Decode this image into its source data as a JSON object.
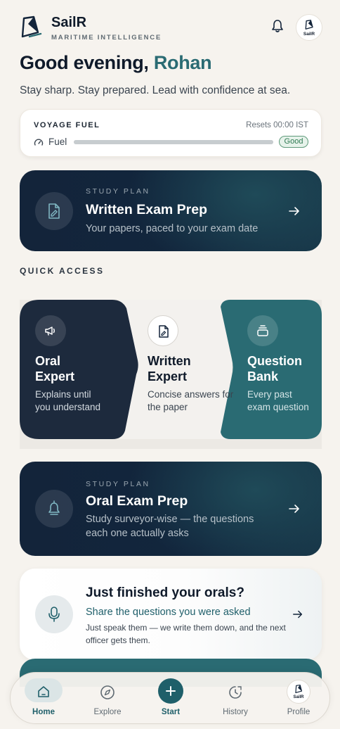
{
  "brand": {
    "name": "SailR",
    "subtitle": "MARITIME INTELLIGENCE",
    "avatar_text": "SailR"
  },
  "greeting": {
    "prefix": "Good evening, ",
    "name": "Rohan",
    "tagline": "Stay sharp. Stay prepared. Lead with confidence at sea."
  },
  "fuel": {
    "title": "VOYAGE FUEL",
    "resets": "Resets 00:00 IST",
    "label": "Fuel",
    "status": "Good",
    "level_percent": 100
  },
  "plans": [
    {
      "kicker": "STUDY PLAN",
      "title": "Written Exam Prep",
      "subtitle": "Your papers, paced to your exam date",
      "icon": "document-icon"
    },
    {
      "kicker": "STUDY PLAN",
      "title": "Oral Exam Prep",
      "subtitle": "Study surveyor-wise — the questions each one actually asks",
      "icon": "bell-icon"
    }
  ],
  "quick_access": {
    "title": "QUICK ACCESS",
    "items": [
      {
        "title": "Oral Expert",
        "subtitle": "Explains until you understand",
        "icon": "megaphone-icon",
        "color": "#1d2a3d"
      },
      {
        "title": "Written Expert",
        "subtitle": "Concise answers for the paper",
        "icon": "document-icon",
        "color": "#f3f1ee"
      },
      {
        "title": "Question Bank",
        "subtitle": "Every past exam question",
        "icon": "stack-icon",
        "color": "#2a6b73"
      }
    ]
  },
  "orals": {
    "title": "Just finished your orals?",
    "link": "Share the questions you were asked",
    "subtitle": "Just speak them — we write them down, and the next officer gets them."
  },
  "nav": {
    "home": "Home",
    "explore": "Explore",
    "start": "Start",
    "history": "History",
    "profile": "Profile",
    "active": "home"
  },
  "colors": {
    "accent": "#2a6b73",
    "navy": "#13243a",
    "background": "#f6f3ee"
  }
}
